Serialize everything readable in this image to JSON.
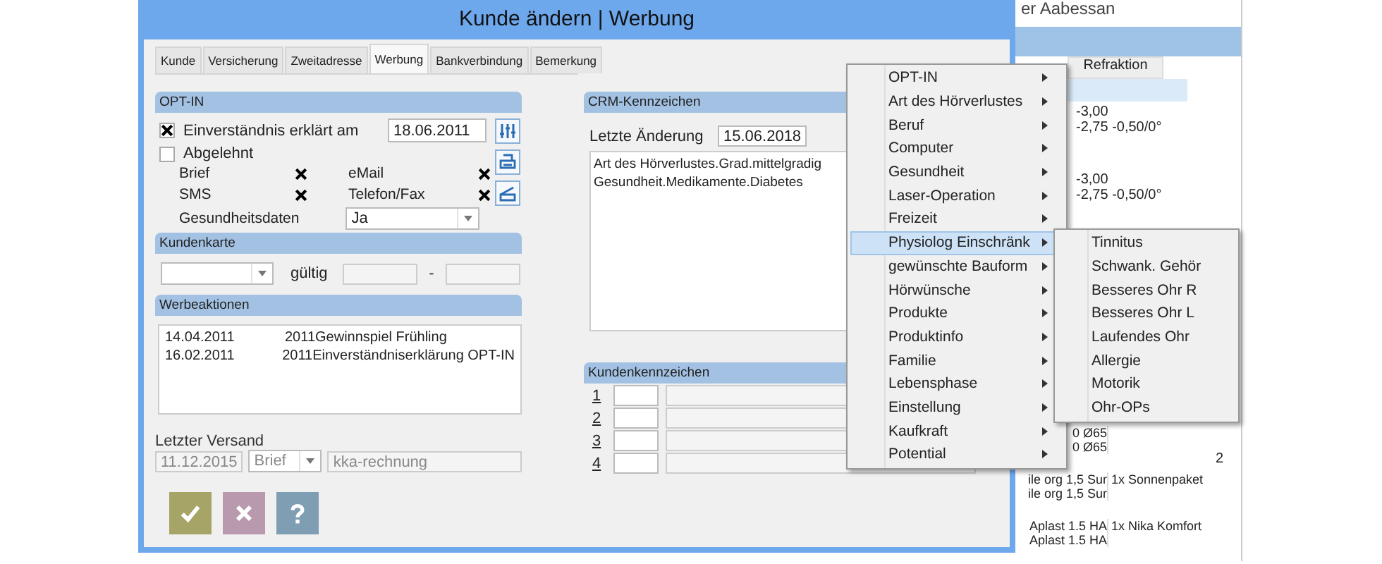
{
  "background_window": {
    "title": "er Aabessan",
    "column_header": "Refraktion",
    "refraction_rows": [
      {
        "selected": true,
        "lines": []
      },
      {
        "selected": false,
        "lines": [
          "-3,00",
          "-2,75  -0,50/0°"
        ]
      },
      {
        "selected": false,
        "lines": []
      },
      {
        "selected": false,
        "lines": [
          "-3,00",
          "-2,75  -0,50/0°"
        ]
      }
    ],
    "lower_rows": [
      {
        "column_1": [
          "0 Ø65",
          "0 Ø65"
        ],
        "column_2": []
      },
      {
        "column_1": [
          "ile org 1,5 Sur",
          "ile org 1,5 Sur"
        ],
        "column_2": [
          "1x Sonnenpaket"
        ]
      },
      {
        "column_1": [
          "Aplast 1.5 HA",
          "Aplast 1.5 HA"
        ],
        "column_2": [
          "1x Nika Komfort"
        ]
      }
    ],
    "side_cell": "2"
  },
  "dialog": {
    "title": "Kunde ändern | Werbung",
    "tabs": [
      {
        "label": "Kunde",
        "selected": false
      },
      {
        "label": "Versicherung",
        "selected": false
      },
      {
        "label": "Zweitadresse",
        "selected": false
      },
      {
        "label": "Werbung",
        "selected": true
      },
      {
        "label": "Bankverbindung",
        "selected": false
      },
      {
        "label": "Bemerkung",
        "selected": false
      }
    ],
    "opt_in": {
      "header": "OPT-IN",
      "consent": {
        "label": "Einverständnis erklärt am",
        "checked": true,
        "date": "18.06.2011"
      },
      "declined": {
        "label": "Abgelehnt",
        "checked": false
      },
      "channels": [
        {
          "label": "Brief",
          "checked": true
        },
        {
          "label": "eMail",
          "checked": true
        },
        {
          "label": "SMS",
          "checked": true
        },
        {
          "label": "Telefon/Fax",
          "checked": true
        }
      ],
      "health": {
        "label": "Gesundheitsdaten",
        "value": "Ja"
      }
    },
    "kundenkarte": {
      "header": "Kundenkarte",
      "valid_label": "gültig",
      "separator": "-"
    },
    "werbeaktionen": {
      "header": "Werbeaktionen",
      "rows": [
        {
          "date": "14.04.2011",
          "text": "2011Gewinnspiel Frühling"
        },
        {
          "date": "16.02.2011",
          "text": "2011Einverständniserklärung OPT-IN"
        }
      ]
    },
    "letzter_versand": {
      "label": "Letzter Versand",
      "date": "11.12.2015",
      "type": "Brief",
      "text": "kka-rechnung"
    },
    "buttons": [
      {
        "kind": "ok"
      },
      {
        "kind": "cancel"
      },
      {
        "kind": "help"
      }
    ],
    "crm": {
      "header": "CRM-Kennzeichen",
      "last_change_label": "Letzte Änderung",
      "last_change_date": "15.06.2018",
      "lines": [
        "Art des Hörverlustes.Grad.mittelgradig",
        "Gesundheit.Medikamente.Diabetes"
      ]
    },
    "kundenkennzeichen": {
      "header": "Kundenkennzeichen",
      "rows": [
        {
          "number": "1"
        },
        {
          "number": "2"
        },
        {
          "number": "3"
        },
        {
          "number": "4"
        }
      ]
    }
  },
  "context_menu": {
    "items": [
      {
        "label": "OPT-IN",
        "selected": false
      },
      {
        "label": "Art des Hörverlustes",
        "selected": false
      },
      {
        "label": "Beruf",
        "selected": false
      },
      {
        "label": "Computer",
        "selected": false
      },
      {
        "label": "Gesundheit",
        "selected": false
      },
      {
        "label": "Laser-Operation",
        "selected": false
      },
      {
        "label": "Freizeit",
        "selected": false
      },
      {
        "label": "Physiolog Einschränk",
        "selected": true
      },
      {
        "label": "gewünschte Bauform",
        "selected": false
      },
      {
        "label": "Hörwünsche",
        "selected": false
      },
      {
        "label": "Produkte",
        "selected": false
      },
      {
        "label": "Produktinfo",
        "selected": false
      },
      {
        "label": "Familie",
        "selected": false
      },
      {
        "label": "Lebensphase",
        "selected": false
      },
      {
        "label": "Einstellung",
        "selected": false
      },
      {
        "label": "Kaufkraft",
        "selected": false
      },
      {
        "label": "Potential",
        "selected": false
      }
    ],
    "submenu": [
      {
        "label": "Tinnitus"
      },
      {
        "label": "Schwank. Gehör"
      },
      {
        "label": "Besseres Ohr R"
      },
      {
        "label": "Besseres Ohr L"
      },
      {
        "label": "Laufendes Ohr"
      },
      {
        "label": "Allergie"
      },
      {
        "label": "Motorik"
      },
      {
        "label": "Ohr-OPs"
      }
    ]
  }
}
